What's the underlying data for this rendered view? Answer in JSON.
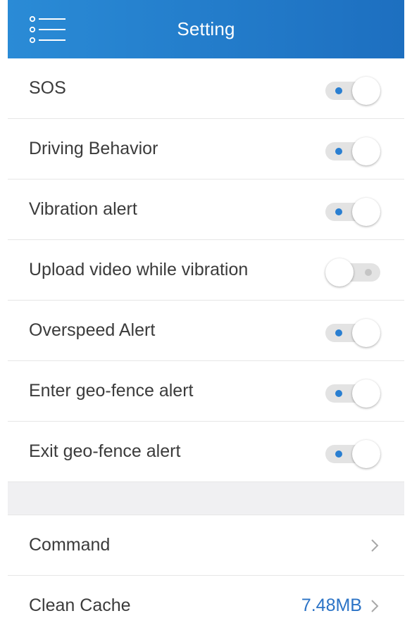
{
  "header": {
    "title": "Setting",
    "menu_icon": "menu-list-icon",
    "background_colors": [
      "#2a8bd6",
      "#1d6fc0"
    ]
  },
  "toggles": [
    {
      "label": "SOS",
      "on": true
    },
    {
      "label": "Driving Behavior",
      "on": true
    },
    {
      "label": "Vibration alert",
      "on": true
    },
    {
      "label": "Upload video while vibration",
      "on": false
    },
    {
      "label": "Overspeed Alert",
      "on": true
    },
    {
      "label": "Enter geo-fence alert",
      "on": true
    },
    {
      "label": "Exit geo-fence alert",
      "on": true
    }
  ],
  "nav_items": [
    {
      "label": "Command",
      "value": "",
      "icon": "chevron-right-icon"
    },
    {
      "label": "Clean Cache",
      "value": "7.48MB",
      "icon": "chevron-right-icon"
    }
  ],
  "colors": {
    "accent": "#2a7fd1",
    "value_text": "#2b73c6",
    "toggle_track": "#e3e3e3",
    "section_gap": "#f0f0f2"
  }
}
